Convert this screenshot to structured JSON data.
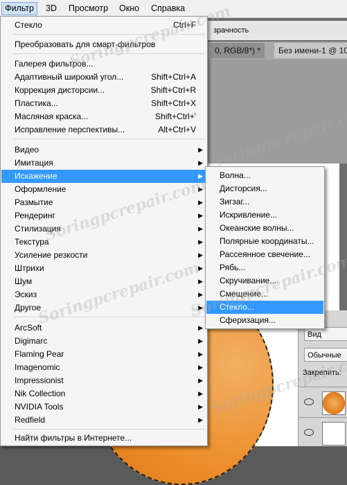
{
  "menubar": {
    "items": [
      {
        "label": "Фильтр",
        "active": true
      },
      {
        "label": "3D"
      },
      {
        "label": "Просмотр"
      },
      {
        "label": "Окно"
      },
      {
        "label": "Справка"
      }
    ]
  },
  "background": {
    "options_text": "зрачность",
    "tab1": "0, RGB/8*) *",
    "tab2": "Без имени-1 @ 10",
    "layers": {
      "kind": "Вид",
      "blend": "Обычные",
      "lock_label": "Закрепить:"
    }
  },
  "filter_menu": {
    "last_filter": {
      "label": "Стекло",
      "shortcut": "Ctrl+F"
    },
    "smart": "Преобразовать для смарт-фильтров",
    "group1": [
      {
        "label": "Галерея фильтров...",
        "shortcut": ""
      },
      {
        "label": "Адаптивный широкий угол...",
        "shortcut": "Shift+Ctrl+A"
      },
      {
        "label": "Коррекция дисторсии...",
        "shortcut": "Shift+Ctrl+R"
      },
      {
        "label": "Пластика...",
        "shortcut": "Shift+Ctrl+X"
      },
      {
        "label": "Масляная краска...",
        "shortcut": "Shift+Ctrl+'"
      },
      {
        "label": "Исправление перспективы...",
        "shortcut": "Alt+Ctrl+V"
      }
    ],
    "group2": [
      "Видео",
      "Имитация",
      "Искажение",
      "Оформление",
      "Размытие",
      "Рендеринг",
      "Стилизация",
      "Текстура",
      "Усиление резкости",
      "Штрихи",
      "Шум",
      "Эскиз",
      "Другое"
    ],
    "group3": [
      "ArcSoft",
      "Digimarc",
      "Flaming Pear",
      "Imagenomic",
      "Impressionist",
      "Nik Collection",
      "NVIDIA Tools",
      "Redfield"
    ],
    "online": "Найти фильтры в Интернете...",
    "highlighted": "Искажение"
  },
  "submenu": {
    "items": [
      "Волна...",
      "Дисторсия...",
      "Зигзаг...",
      "Искривление...",
      "Океанские волны...",
      "Полярные координаты...",
      "Рассеянное свечение...",
      "Рябь...",
      "Скручивание...",
      "Смещение...",
      "Стекло...",
      "Сферизация..."
    ],
    "highlighted": "Стекло..."
  },
  "watermark": "Soringpcrepair.com",
  "colors": {
    "highlight": "#3399ff",
    "menu_bg": "#f5f5f5",
    "orange": "#ec8e2b"
  }
}
